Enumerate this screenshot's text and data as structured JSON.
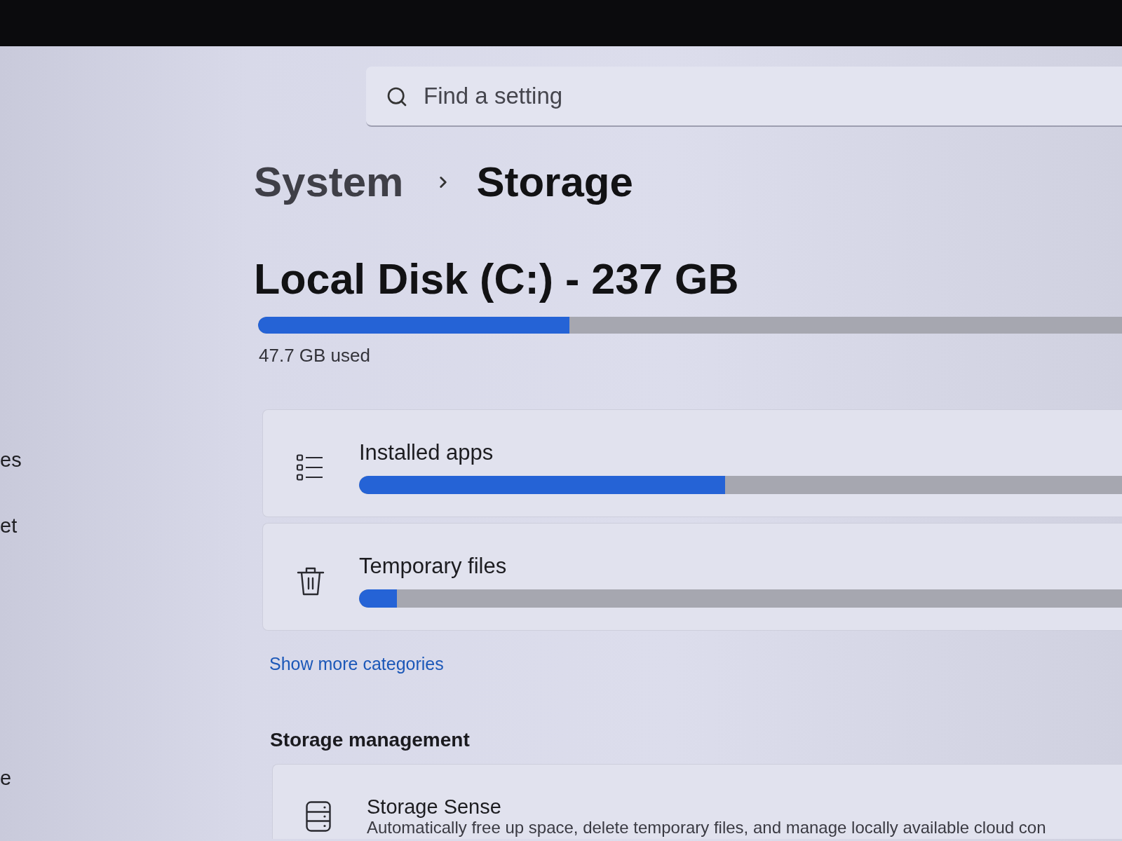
{
  "search": {
    "placeholder": "Find a setting"
  },
  "sidebar": {
    "items": [
      {
        "label": "es"
      },
      {
        "label": "et"
      },
      {
        "label": "e"
      }
    ]
  },
  "breadcrumb": [
    {
      "label": "System"
    },
    {
      "label": "Storage"
    }
  ],
  "disk": {
    "title": "Local Disk (C:) - 237 GB",
    "level": 0.36,
    "usage": "47.7 GB used"
  },
  "categories": [
    {
      "kind": "apps",
      "label": "Installed apps",
      "level": 0.48
    },
    {
      "kind": "temp",
      "label": "Temporary files",
      "level": 0.05
    }
  ],
  "show_more": "Show more categories",
  "storage_management": {
    "heading": "Storage management",
    "items": [
      {
        "kind": "storage_sense",
        "title": "Storage Sense",
        "description": "Automatically free up space, delete temporary files, and manage locally available cloud con"
      }
    ]
  }
}
